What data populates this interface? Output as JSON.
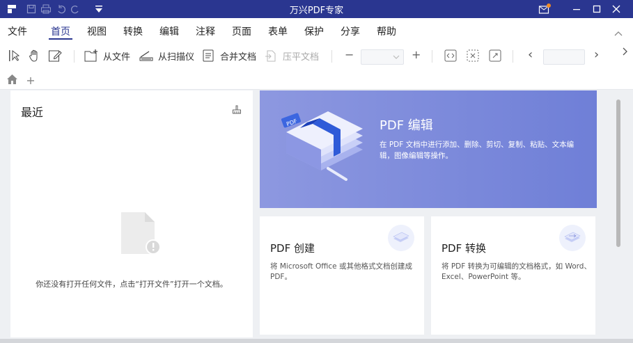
{
  "window": {
    "title": "万兴PDF专家"
  },
  "menu": {
    "items": [
      {
        "label": "文件"
      },
      {
        "label": "首页"
      },
      {
        "label": "视图"
      },
      {
        "label": "转换"
      },
      {
        "label": "编辑"
      },
      {
        "label": "注释"
      },
      {
        "label": "页面"
      },
      {
        "label": "表单"
      },
      {
        "label": "保护"
      },
      {
        "label": "分享"
      },
      {
        "label": "帮助"
      }
    ],
    "active": "首页"
  },
  "toolbar": {
    "from_file": "从文件",
    "from_scanner": "从扫描仪",
    "merge_docs": "合并文档",
    "flatten_doc": "压平文档",
    "zoom_minus": "−",
    "zoom_plus": "+",
    "prev": "‹",
    "next": "›"
  },
  "recent": {
    "title": "最近",
    "empty_text": "你还没有打开任何文件，点击“打开文件”打开一个文档。"
  },
  "hero": {
    "title": "PDF 编辑",
    "desc": "在 PDF 文档中进行添加、删除、剪切、复制、粘贴、文本编辑，图像编辑等操作。",
    "badge": "PDF"
  },
  "cards": [
    {
      "title": "PDF 创建",
      "desc": "将 Microsoft Office 或其他格式文档创建成 PDF。"
    },
    {
      "title": "PDF 转换",
      "desc": "将 PDF 转换为可编辑的文档格式，如 Word、Excel、PowerPoint 等。"
    }
  ],
  "colors": {
    "titlebar": "#2a3690",
    "hero": "#7a87dc",
    "notification_dot": "#f08a24"
  }
}
